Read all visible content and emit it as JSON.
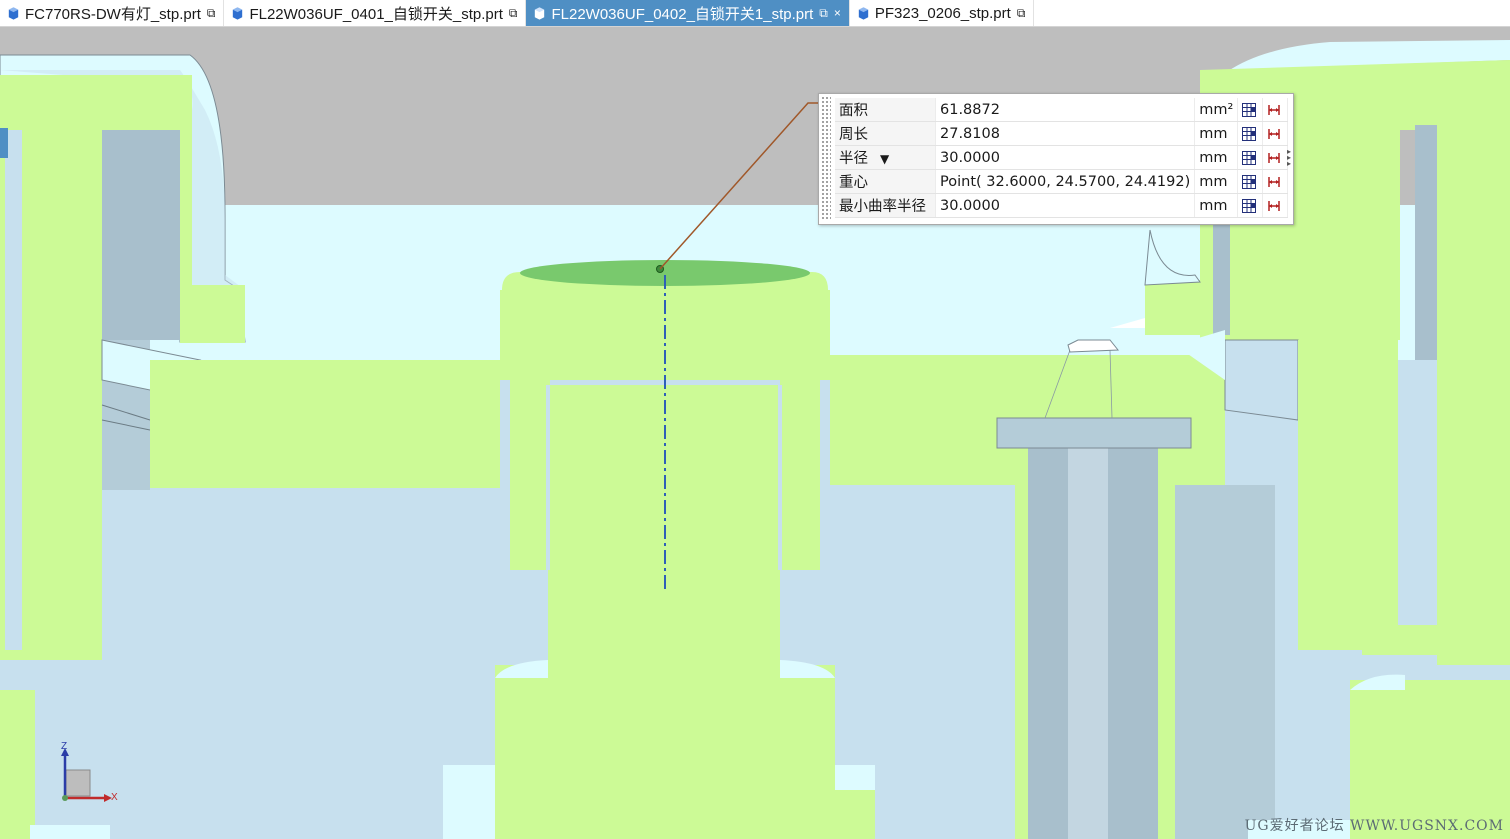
{
  "tabs": [
    {
      "label": "FC770RS-DW有灯_stp.prt",
      "icon": "part-file-icon",
      "active": false
    },
    {
      "label": "FL22W036UF_0401_自锁开关_stp.prt",
      "icon": "part-file-icon",
      "active": false
    },
    {
      "label": "FL22W036UF_0402_自锁开关1_stp.prt",
      "icon": "part-file-icon",
      "active": true
    },
    {
      "label": "PF323_0206_stp.prt",
      "icon": "part-file-icon",
      "active": false
    }
  ],
  "tab_action_icons": {
    "popout": "popout-icon",
    "close": "×"
  },
  "measure": {
    "rows": [
      {
        "name": "面积",
        "value": "61.8872",
        "unit": "mm²"
      },
      {
        "name": "周长",
        "value": "27.8108",
        "unit": "mm"
      },
      {
        "name": "半径",
        "value": "30.0000",
        "unit": "mm",
        "dropdown": "▼"
      },
      {
        "name": "重心",
        "value": "Point( 32.6000, 24.5700, 24.4192)",
        "unit": "mm"
      },
      {
        "name": "最小曲率半径",
        "value": "30.0000",
        "unit": "mm"
      }
    ],
    "row_icons": [
      "table-icon",
      "dimension-icon"
    ],
    "side_arrows": "▸▸▸"
  },
  "triad": {
    "z_label": "Z",
    "x_label": "X"
  },
  "watermark": "UG爱好者论坛 WWW.UGSNX.COM",
  "colors": {
    "model_green": "#ccfa96",
    "model_blue": "#c7e0ee",
    "background_gray": "#bebebe",
    "pale_cyan": "#ddfbff",
    "selected_face": "#79c96d",
    "tab_active": "#4f8fc4",
    "leader_line": "#a0582a"
  }
}
